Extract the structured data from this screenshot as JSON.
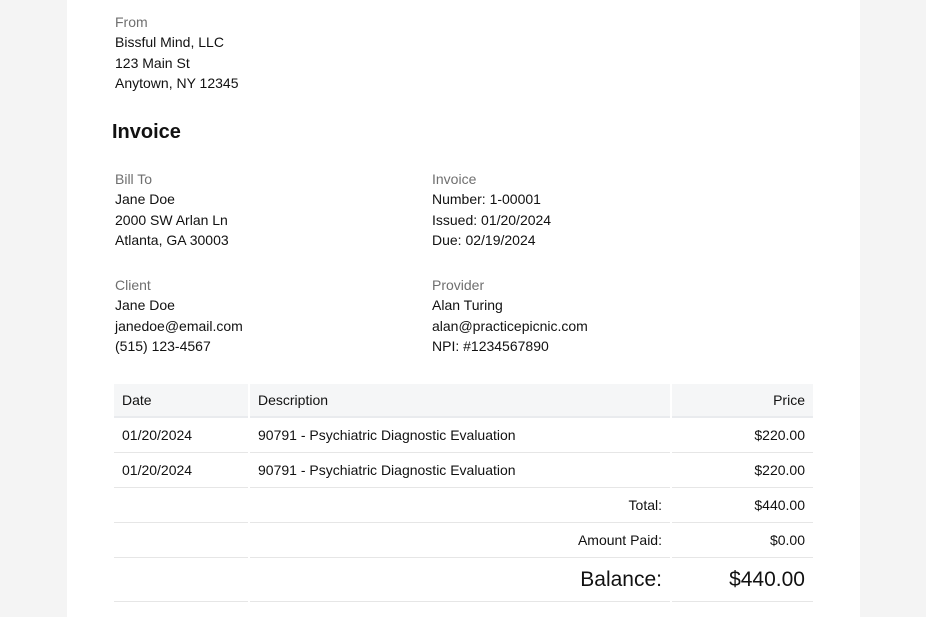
{
  "from": {
    "label": "From",
    "name": "Bissful Mind, LLC",
    "street": "123 Main St",
    "city": "Anytown, NY 12345"
  },
  "title": "Invoice",
  "bill_to": {
    "label": "Bill To",
    "name": "Jane Doe",
    "street": "2000 SW Arlan Ln",
    "city": "Atlanta, GA 30003"
  },
  "invoice": {
    "label": "Invoice",
    "number": "Number: 1-00001",
    "issued": "Issued: 01/20/2024",
    "due": "Due: 02/19/2024"
  },
  "client": {
    "label": "Client",
    "name": "Jane Doe",
    "email": "janedoe@email.com",
    "phone": "(515) 123-4567"
  },
  "provider": {
    "label": "Provider",
    "name": "Alan Turing",
    "email": "alan@practicepicnic.com",
    "npi": "NPI: #1234567890"
  },
  "table": {
    "headers": [
      "Date",
      "Description",
      "Price"
    ],
    "rows": [
      [
        "01/20/2024",
        "90791 - Psychiatric Diagnostic Evaluation",
        "$220.00"
      ],
      [
        "01/20/2024",
        "90791 - Psychiatric Diagnostic Evaluation",
        "$220.00"
      ]
    ],
    "total_label": "Total:",
    "total_value": "$440.00",
    "paid_label": "Amount Paid:",
    "paid_value": "$0.00",
    "balance_label": "Balance:",
    "balance_value": "$440.00"
  }
}
